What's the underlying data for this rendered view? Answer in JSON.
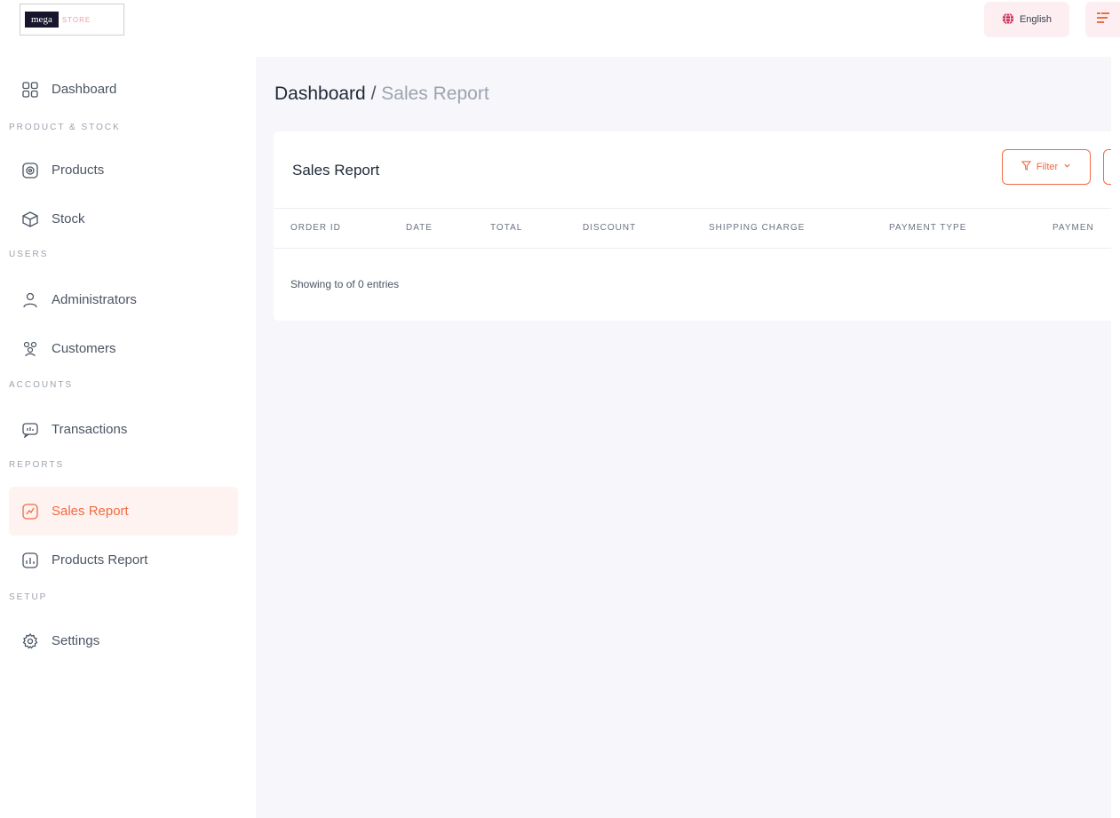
{
  "logo": {
    "dark_text": "mega",
    "light_text": "STORE"
  },
  "header": {
    "language_label": "English",
    "icons": {
      "language": "globe-icon",
      "menu": "menu-icon"
    },
    "accent_color": "#f26b43"
  },
  "sidebar": {
    "dashboard": {
      "label": "Dashboard",
      "icon": "dashboard-icon"
    },
    "sections": {
      "product_stock": "PRODUCT & STOCK",
      "users": "USERS",
      "accounts": "ACCOUNTS",
      "reports": "REPORTS",
      "setup": "SETUP"
    },
    "items": {
      "products": {
        "label": "Products",
        "icon": "products-icon"
      },
      "stock": {
        "label": "Stock",
        "icon": "stock-icon"
      },
      "administrators": {
        "label": "Administrators",
        "icon": "user-icon"
      },
      "customers": {
        "label": "Customers",
        "icon": "users-icon"
      },
      "transactions": {
        "label": "Transactions",
        "icon": "transactions-icon"
      },
      "sales_report": {
        "label": "Sales Report",
        "icon": "sales-report-icon",
        "active": true
      },
      "products_report": {
        "label": "Products Report",
        "icon": "products-report-icon"
      },
      "settings": {
        "label": "Settings",
        "icon": "gear-icon"
      }
    }
  },
  "main": {
    "breadcrumb": {
      "root": "Dashboard",
      "separator": "/",
      "current": "Sales Report"
    },
    "card": {
      "title": "Sales Report",
      "filter_label": "Filter",
      "columns": [
        "ORDER ID",
        "DATE",
        "TOTAL",
        "DISCOUNT",
        "SHIPPING CHARGE",
        "PAYMENT TYPE",
        "PAYMEN"
      ],
      "rows": [],
      "showing_text": "Showing to of 0 entries"
    }
  }
}
